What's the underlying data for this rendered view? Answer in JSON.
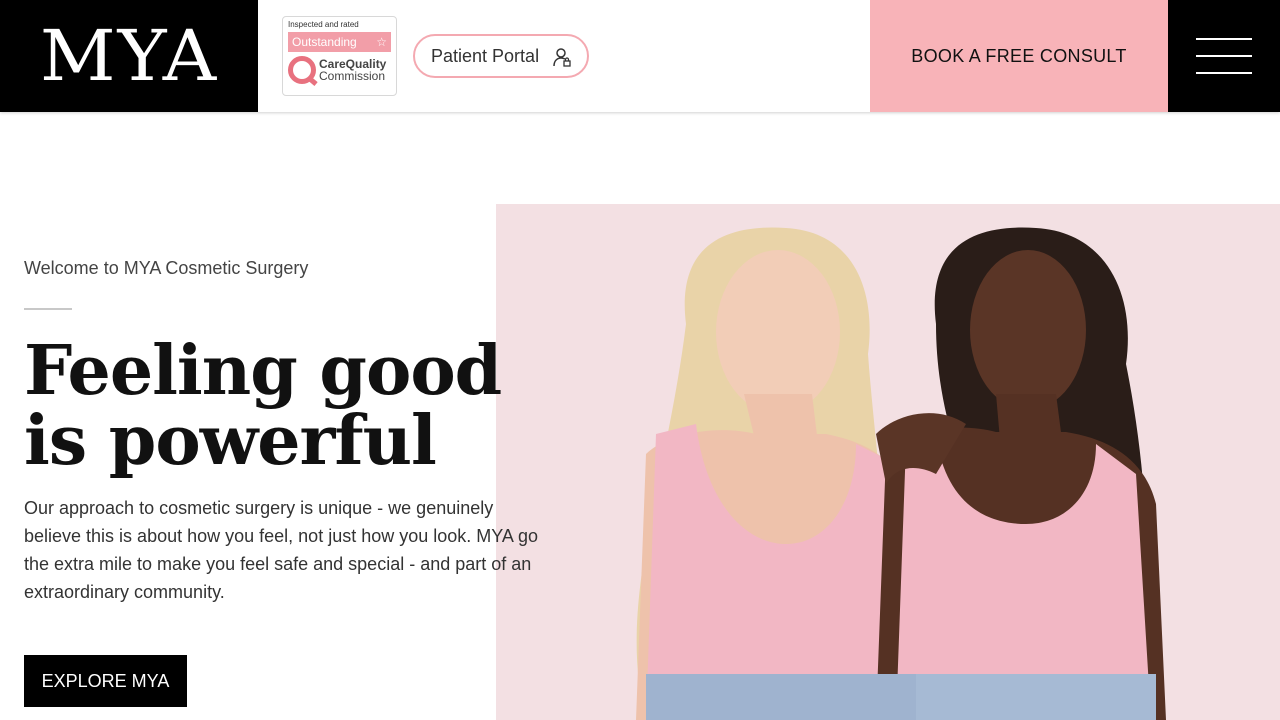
{
  "header": {
    "logo": "MYA",
    "cqc": {
      "top_text": "Inspected and rated",
      "rating": "Outstanding",
      "org_line1": "CareQuality",
      "org_line2": "Commission"
    },
    "portal_label": "Patient Portal",
    "book_label": "BOOK A FREE CONSULT"
  },
  "hero": {
    "intro": "Welcome to MYA Cosmetic Surgery",
    "headline_line1": "Feeling good",
    "headline_line2": "is powerful",
    "body": "Our approach to cosmetic surgery is unique - we genuinely believe this is about how you feel, not just how you look. MYA go the extra mile to make you feel safe and special - and part of an   extraordinary community.",
    "cta_label": "EXPLORE MYA",
    "image_alt": "two women in pink vests"
  },
  "colors": {
    "accent_pink": "#f8b3b8",
    "cqc_pink": "#f29ea8",
    "image_bg": "#f3e0e3"
  }
}
